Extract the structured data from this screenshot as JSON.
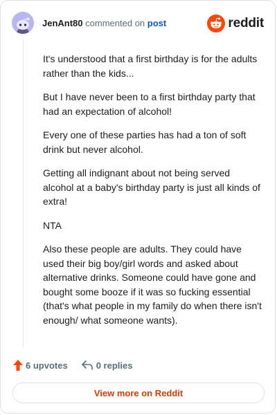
{
  "header": {
    "username": "JenAnt80",
    "action_text": "commented on",
    "post_link": "post",
    "brand": "reddit"
  },
  "comment": {
    "paragraphs": [
      "It's understood that a first birthday is for the adults rather than the kids...",
      "But I have never been to a first birthday party that had an expectation of alcohol!",
      "Every one of these parties has had a ton of soft drink but never alcohol.",
      "Getting all indignant about not being served alcohol at a baby's birthday party is just all kinds of extra!",
      "NTA",
      "Also these people are adults. They could have used their big boy/girl words and asked about alternative drinks. Someone could have gone and bought some booze if it was so fucking essential (that's what people in my family do when there isn't enough/ what someone wants)."
    ]
  },
  "actions": {
    "upvotes": "6 upvotes",
    "replies": "0 replies"
  },
  "footer": {
    "view_more": "View more on Reddit"
  },
  "colors": {
    "brand_orange": "#ff4500",
    "link_blue": "#0b57d0",
    "muted": "#576f76",
    "view_more": "#d93a00",
    "avatar_bg": "#b8b6f0"
  },
  "icons": {
    "avatar": "snoo-avatar-icon",
    "logo": "reddit-logo-icon",
    "upvote": "upvote-arrow-icon",
    "reply": "reply-arrow-icon"
  }
}
